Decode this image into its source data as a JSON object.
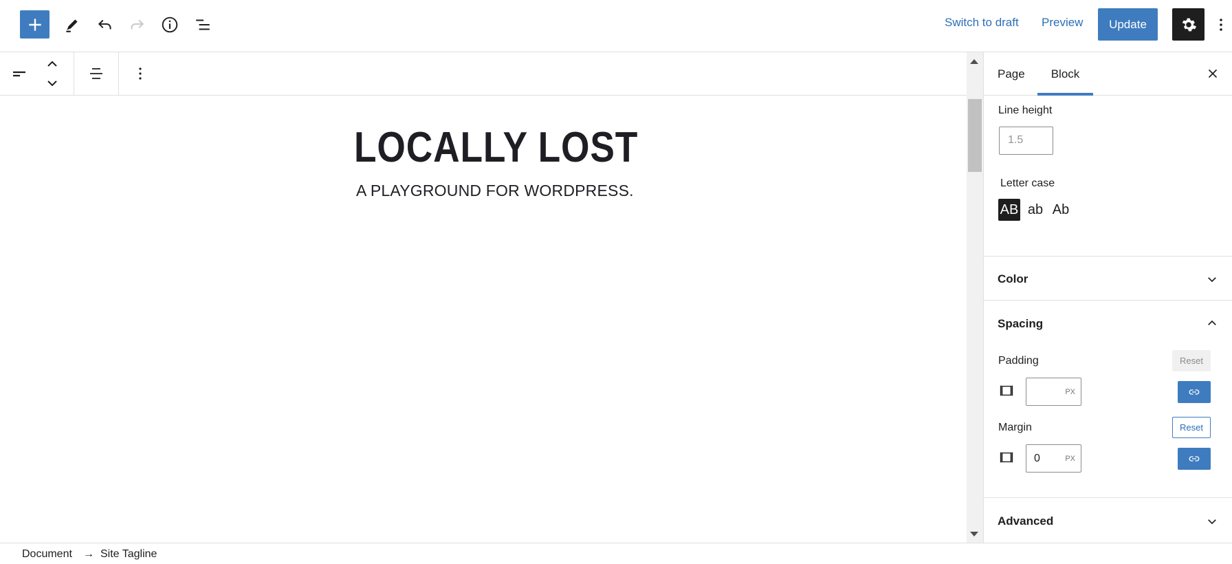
{
  "header": {
    "add_icon": "plus-icon",
    "tools_icon": "pencil-icon",
    "undo_icon": "undo-icon",
    "redo_icon": "redo-icon",
    "details_icon": "info-icon",
    "list_view_icon": "list-view-icon",
    "switch_to_draft": "Switch to draft",
    "preview": "Preview",
    "update": "Update",
    "settings_icon": "gear-icon",
    "options_icon": "vertical-ellipsis-icon"
  },
  "block_toolbar": {
    "block_type_icon": "site-tagline-icon",
    "move_icon": "move-up-down-icon",
    "align_icon": "align-center-icon",
    "more_icon": "vertical-ellipsis-icon"
  },
  "canvas": {
    "site_title": "LOCALLY LOST",
    "site_tagline": "A PLAYGROUND FOR WORDPRESS."
  },
  "sidebar": {
    "tabs": [
      {
        "label": "Page",
        "active": false
      },
      {
        "label": "Block",
        "active": true
      }
    ],
    "close_icon": "close-icon",
    "typography": {
      "line_height_label": "Line height",
      "line_height_placeholder": "1.5",
      "letter_case_label": "Letter case",
      "letter_case_options": [
        {
          "label": "AB",
          "active": true
        },
        {
          "label": "ab",
          "active": false
        },
        {
          "label": "Ab",
          "active": false
        }
      ]
    },
    "panels": {
      "color": "Color",
      "spacing": "Spacing",
      "advanced": "Advanced"
    },
    "spacing": {
      "padding_label": "Padding",
      "padding_reset": "Reset",
      "padding_value": "",
      "padding_unit": "PX",
      "margin_label": "Margin",
      "margin_reset": "Reset",
      "margin_value": "0",
      "margin_unit": "PX"
    }
  },
  "footer": {
    "breadcrumbs": [
      "Document",
      "Site Tagline"
    ],
    "separator": "→"
  },
  "colors": {
    "accent": "#3f7cbf",
    "dark": "#1e1e1e"
  }
}
